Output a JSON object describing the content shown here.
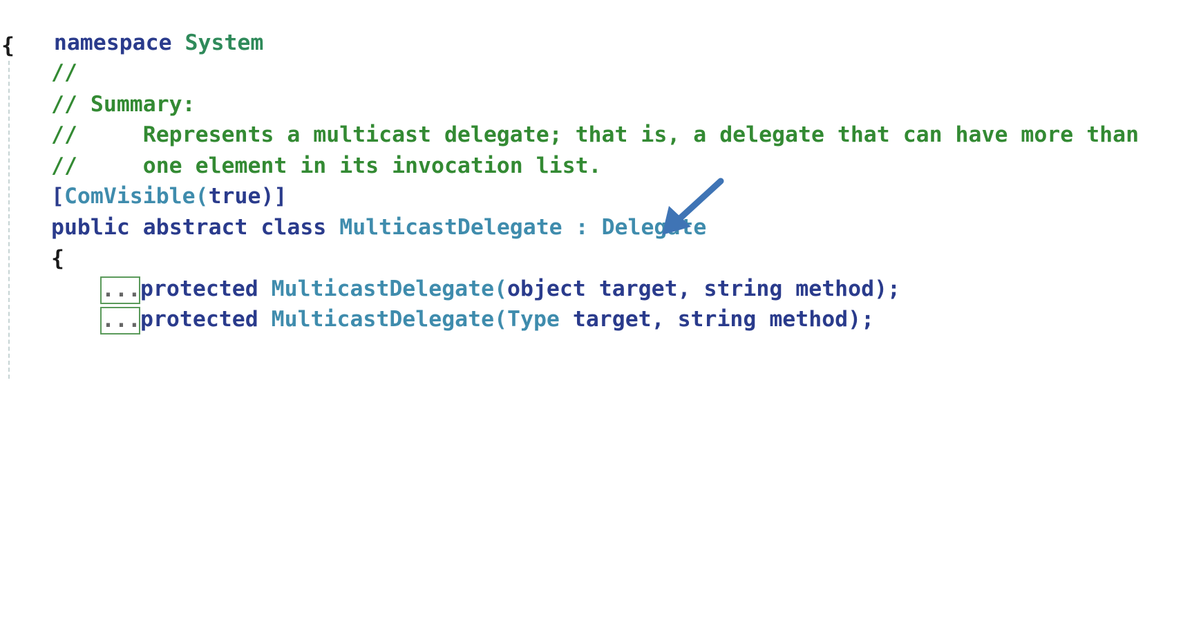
{
  "editor": {
    "ns_keyword": "namespace",
    "ns_name": "System",
    "open_brace": "{",
    "comment_1": "//",
    "comment_2": "// Summary:",
    "comment_3": "//     Represents a multicast delegate; that is, a delegate that can have more than",
    "comment_4": "//     one element in its invocation list.",
    "attr_open": "[",
    "attr_name": "ComVisible",
    "attr_paren_open": "(",
    "attr_value": "true",
    "attr_close": ")]",
    "cls_public": "public",
    "cls_abstract": "abstract",
    "cls_class": "class",
    "cls_name": "MulticastDelegate",
    "cls_colon": ":",
    "cls_base": "Delegate",
    "class_open_brace": "{",
    "members": [
      {
        "collapsed": "...",
        "modifier": "protected",
        "name": "MulticastDelegate",
        "paren": "(",
        "param1_type": "object",
        "param1_name": " target, ",
        "param2_type": "string",
        "param2_name": " method);"
      },
      {
        "collapsed": "...",
        "modifier": "protected",
        "name": "MulticastDelegate",
        "paren": "(",
        "param1_type": "Type",
        "param1_name": " target, ",
        "param2_type": "string",
        "param2_name": " method);"
      }
    ]
  },
  "colors": {
    "keyword": "#2a3b8c",
    "type": "#3f8cad",
    "comment": "#338a33",
    "arrow": "#3f74b5",
    "collapsed_border": "#5a9a5a"
  },
  "icons": {
    "callout": "arrow-icon"
  }
}
